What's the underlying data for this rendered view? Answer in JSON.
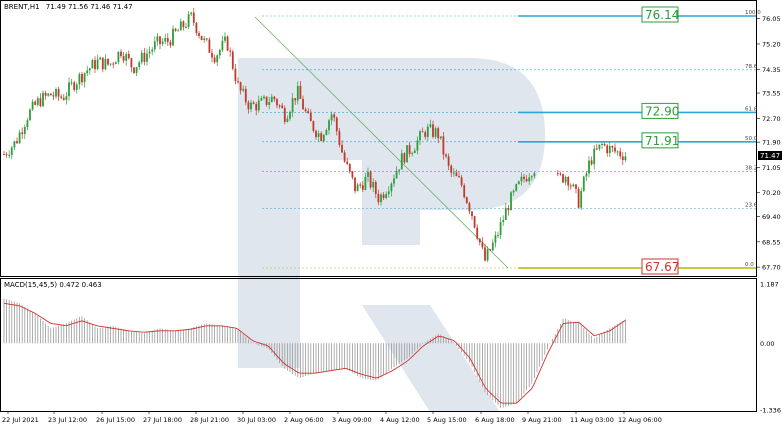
{
  "header": {
    "symbol": "BRENT,H1",
    "ohlc": "71.49 71.56 71.46 71.47"
  },
  "macd_label": "MACD(15,45,5) 0.472 0.463",
  "current_price_label": "71.47",
  "colors": {
    "bull": "#2e9d3a",
    "bear": "#c0392b",
    "fib_line": "#2aa7d6",
    "fib_label_box": "#2e9d3a",
    "fib_low_line": "#b8b800",
    "fib_low_box": "#d0312d",
    "watermark": "#dfe6ee",
    "macd_hist": "#9a9a9a",
    "macd_signal": "#d0312d",
    "trend_line": "#6ab06a"
  },
  "fib_levels": [
    {
      "pct": "100.0",
      "price": 76.14,
      "label": "76.14",
      "box": true
    },
    {
      "pct": "78.6",
      "price": 74.33,
      "label": "",
      "box": false
    },
    {
      "pct": "61.8",
      "price": 72.9,
      "label": "72.90",
      "box": true
    },
    {
      "pct": "50.0",
      "price": 71.91,
      "label": "71.91",
      "box": true
    },
    {
      "pct": "38.2",
      "price": 70.91,
      "label": "",
      "box": false
    },
    {
      "pct": "23.6",
      "price": 69.67,
      "label": "",
      "box": false
    },
    {
      "pct": "0.0",
      "price": 67.67,
      "label": "67.67",
      "box": true,
      "low": true
    }
  ],
  "chart_data": {
    "type": "candlestick",
    "main_y_ticks": [
      "76.05",
      "75.20",
      "74.35",
      "73.55",
      "72.70",
      "71.90",
      "71.05",
      "70.20",
      "69.40",
      "68.55",
      "67.70"
    ],
    "main_ylim": [
      67.5,
      76.4
    ],
    "x_ticks": [
      "22 Jul 2021",
      "23 Jul 12:00",
      "26 Jul 15:00",
      "27 Jul 18:00",
      "28 Jul 21:00",
      "30 Jul 03:00",
      "2 Aug 06:00",
      "3 Aug 09:00",
      "4 Aug 12:00",
      "5 Aug 15:00",
      "6 Aug 18:00",
      "9 Aug 21:00",
      "11 Aug 03:00",
      "12 Aug 06:00"
    ],
    "close_path": [
      71.5,
      71.9,
      72.8,
      73.3,
      73.5,
      73.4,
      73.9,
      74.3,
      74.6,
      74.5,
      75.0,
      74.4,
      74.8,
      75.2,
      75.3,
      75.7,
      76.1,
      75.3,
      74.8,
      75.3,
      73.7,
      73.1,
      73.2,
      73.4,
      72.8,
      73.6,
      72.6,
      72.1,
      72.9,
      71.3,
      70.3,
      70.7,
      70.0,
      70.6,
      71.4,
      71.8,
      72.3,
      72.2,
      70.9,
      70.5,
      69.4,
      67.9,
      68.7,
      69.8,
      70.5,
      71.0,
      71.2,
      70.6,
      70.8,
      69.9,
      71.3,
      71.8,
      71.6,
      71.47
    ],
    "macd_ylim": [
      -1.336,
      1.187
    ],
    "macd_y_ticks": [
      "1.187",
      "0.00",
      "-1.336"
    ],
    "macd_hist_path": [
      0.9,
      0.8,
      0.6,
      0.3,
      0.4,
      0.55,
      0.3,
      0.35,
      0.25,
      0.2,
      0.3,
      0.25,
      0.3,
      0.4,
      0.35,
      0.3,
      0.0,
      -0.1,
      -0.5,
      -0.7,
      -0.6,
      -0.55,
      -0.5,
      -0.7,
      -0.75,
      -0.5,
      -0.3,
      0.0,
      0.2,
      0.0,
      -0.4,
      -1.0,
      -1.3,
      -1.2,
      -0.8,
      -0.1,
      0.5,
      0.4,
      0.1,
      0.3,
      0.48
    ],
    "macd_signal_path": [
      0.8,
      0.75,
      0.6,
      0.4,
      0.35,
      0.45,
      0.35,
      0.3,
      0.25,
      0.22,
      0.25,
      0.25,
      0.28,
      0.35,
      0.35,
      0.3,
      0.05,
      -0.05,
      -0.4,
      -0.6,
      -0.6,
      -0.55,
      -0.5,
      -0.62,
      -0.7,
      -0.55,
      -0.35,
      -0.05,
      0.15,
      0.05,
      -0.3,
      -0.9,
      -1.2,
      -1.2,
      -0.9,
      -0.2,
      0.4,
      0.42,
      0.15,
      0.25,
      0.46
    ]
  }
}
